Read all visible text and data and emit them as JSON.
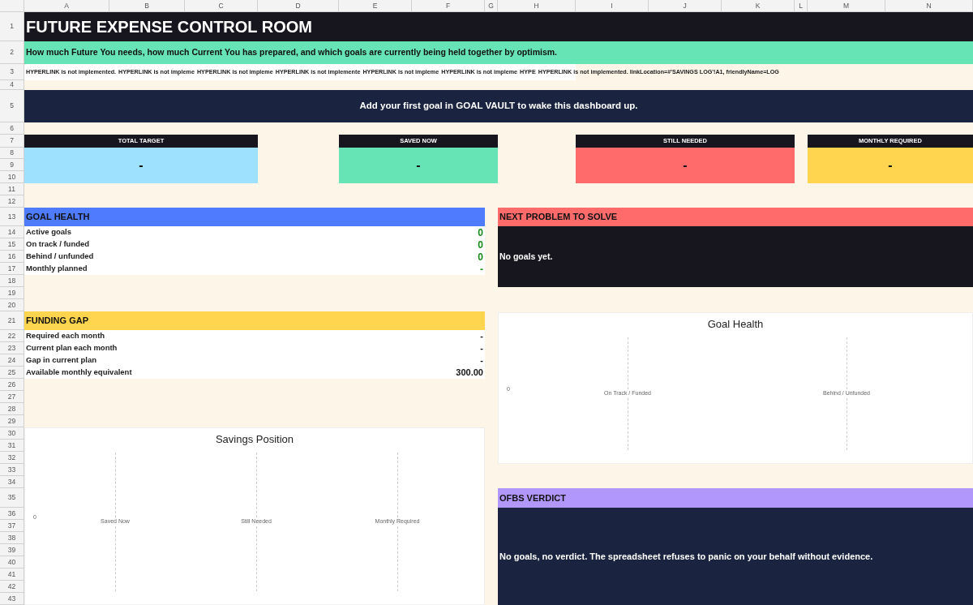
{
  "columns": [
    "A",
    "B",
    "C",
    "D",
    "E",
    "F",
    "G",
    "H",
    "I",
    "J",
    "K",
    "L",
    "M",
    "N"
  ],
  "rows": [
    "1",
    "2",
    "3",
    "4",
    "5",
    "6",
    "7",
    "8",
    "9",
    "10",
    "11",
    "12",
    "13",
    "14",
    "15",
    "16",
    "17",
    "18",
    "19",
    "20",
    "21",
    "22",
    "23",
    "24",
    "25",
    "26",
    "27",
    "28",
    "29",
    "30",
    "31",
    "32",
    "33",
    "34",
    "35",
    "36",
    "37",
    "38",
    "39",
    "40",
    "41",
    "42",
    "43"
  ],
  "title": "FUTURE EXPENSE CONTROL ROOM",
  "subtitle": "How much Future You needs, how much Current You has prepared, and which goals are currently being held together by optimism.",
  "link_errors": [
    "HYPERLINK is not implemented.",
    "HYPERLINK is not impleme",
    "HYPERLINK is not impleme",
    "HYPERLINK is not implemente",
    "HYPERLINK is not impleme",
    "HYPERLINK is not impleme",
    "HYPE",
    "HYPERLINK is not implemented. linkLocation=#'SAVINGS LOG'!A1, friendlyName=LOG"
  ],
  "banner": "Add your first goal in GOAL VAULT to wake this dashboard up.",
  "kpis": [
    {
      "label": "TOTAL TARGET",
      "value": "-",
      "color": "#9de1fe"
    },
    {
      "label": "SAVED NOW",
      "value": "-",
      "color": "#67e4b5"
    },
    {
      "label": "STILL NEEDED",
      "value": "-",
      "color": "#ff6b6b"
    },
    {
      "label": "MONTHLY REQUIRED",
      "value": "-",
      "color": "#ffd54f"
    }
  ],
  "goal_health": {
    "title": "GOAL HEALTH",
    "rows": [
      {
        "label": "Active goals",
        "value": "0"
      },
      {
        "label": "On track / funded",
        "value": "0"
      },
      {
        "label": "Behind / unfunded",
        "value": "0"
      },
      {
        "label": "Monthly planned",
        "value": "-"
      }
    ]
  },
  "next_problem": {
    "title": "NEXT PROBLEM TO SOLVE",
    "text": "No goals yet."
  },
  "funding_gap": {
    "title": "FUNDING GAP",
    "rows": [
      {
        "label": "Required each month",
        "value": "-"
      },
      {
        "label": "Current plan each month",
        "value": "-"
      },
      {
        "label": "Gap in current plan",
        "value": "-"
      },
      {
        "label": "Available monthly equivalent",
        "value": "300.00"
      }
    ]
  },
  "goal_health_chart": {
    "title": "Goal Health",
    "axis_label": "0",
    "categories": [
      "On Track / Funded",
      "Behind / Unfunded"
    ]
  },
  "savings_chart": {
    "title": "Savings Position",
    "axis_label": "0",
    "categories": [
      "Saved Now",
      "Still Needed",
      "Monthly Required"
    ]
  },
  "verdict": {
    "title": "OFBS VERDICT",
    "text": "No goals, no verdict. The spreadsheet refuses to panic on your behalf without evidence."
  }
}
